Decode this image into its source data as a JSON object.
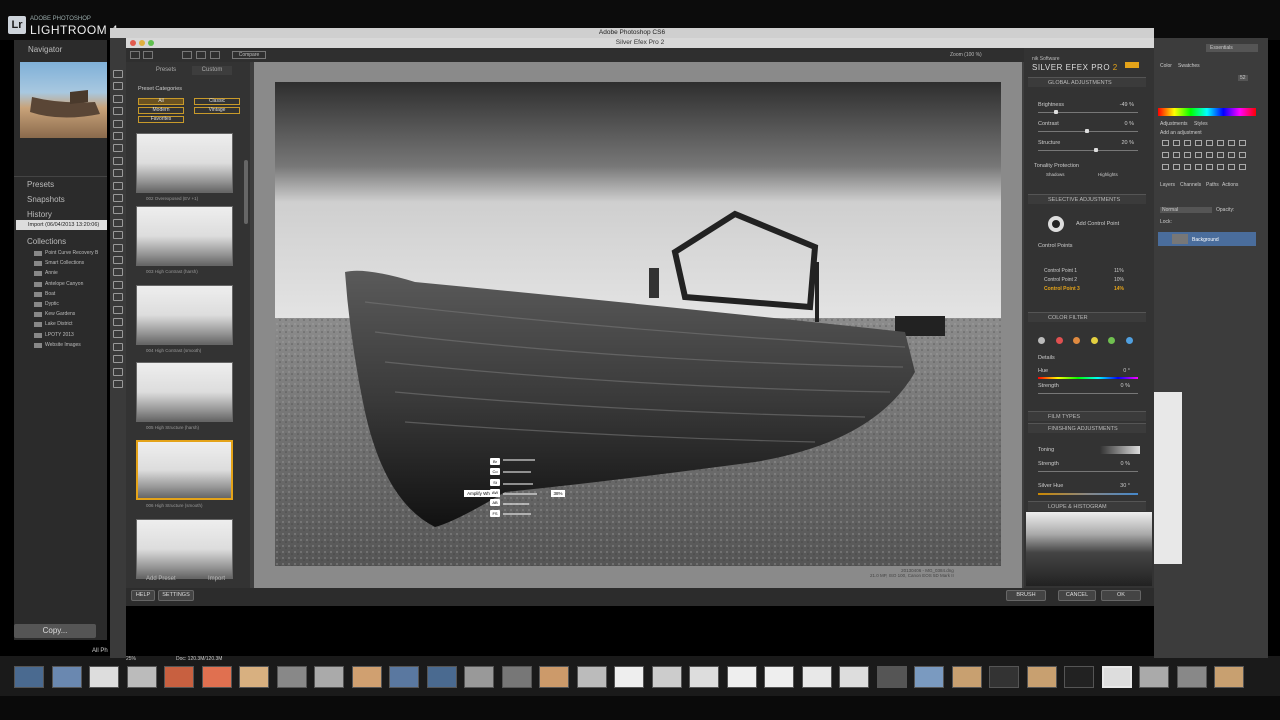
{
  "lightroom": {
    "brand_small": "ADOBE PHOTOSHOP",
    "brand_big": "LIGHTROOM 4",
    "logo": "Lr",
    "navigator": "Navigator",
    "presets": "Presets",
    "snapshots": "Snapshots",
    "history": "History",
    "history_item": "Import (06/04/2013 13:20:06)",
    "collections": "Collections",
    "collection_items": [
      "Point Curve Recovery B",
      "Smart Collections",
      "Annie",
      "Antelope Canyon",
      "Boat",
      "Dyptic",
      "Kew Gardens",
      "Lake District",
      "LPOTY 2013",
      "Website Images"
    ],
    "copy_button": "Copy...",
    "all_photos": "All Ph"
  },
  "photoshop": {
    "title": "Adobe Photoshop CS6",
    "workspace": "Essentials",
    "color_tab": "Color",
    "swatches_tab": "Swatches",
    "adjustments_tab": "Adjustments",
    "styles_tab": "Styles",
    "add_adjustment": "Add an adjustment",
    "layers_tab": "Layers",
    "channels_tab": "Channels",
    "paths_tab": "Paths",
    "actions_tab": "Actions",
    "blend_mode": "Normal",
    "opacity_label": "Opacity:",
    "lock_label": "Lock:",
    "layer_name": "Background",
    "color_value": "52",
    "doc_zoom": "25%",
    "doc_size": "Doc: 120.3M/120.3M"
  },
  "silver_efex": {
    "title": "Silver Efex Pro 2",
    "compare_button": "Compare",
    "zoom_label": "Zoom (100 %)",
    "tabs": [
      "Presets",
      "Custom"
    ],
    "preset_categories_label": "Preset Categories",
    "categories": [
      "All",
      "Classic",
      "Modern",
      "Vintage",
      "Favorites"
    ],
    "presets": [
      "002 Overexposed (EV +1)",
      "003 High Contrast (harsh)",
      "004 High Contrast (smooth)",
      "005 High Structure (harsh)",
      "006 High Structure (smooth)"
    ],
    "add_preset": "Add Preset",
    "import": "Import",
    "logo_company": "nik Software",
    "logo_product": "SILVER EFEX PRO",
    "logo_version": "2",
    "global_adjustments": "GLOBAL ADJUSTMENTS",
    "brightness_label": "Brightness",
    "brightness_value": "-49 %",
    "contrast_label": "Contrast",
    "contrast_value": "0 %",
    "structure_label": "Structure",
    "structure_value": "20 %",
    "tonality_protection": "Tonality Protection",
    "shadows": "Shadows",
    "highlights": "Highlights",
    "selective_adjustments": "SELECTIVE ADJUSTMENTS",
    "add_control_point": "Add Control Point",
    "control_points_label": "Control Points",
    "control_points": [
      {
        "name": "Control Point 1",
        "value": "11%"
      },
      {
        "name": "Control Point 2",
        "value": "10%"
      },
      {
        "name": "Control Point 3",
        "value": "14%"
      }
    ],
    "color_filter": "COLOR FILTER",
    "details": "Details",
    "hue_label": "Hue",
    "hue_value": "0 °",
    "strength_label": "Strength",
    "strength_value": "0 %",
    "film_types": "FILM TYPES",
    "finishing_adjustments": "FINISHING ADJUSTMENTS",
    "toning_label": "Toning",
    "toning_strength_label": "Strength",
    "toning_strength_value": "0 %",
    "silver_hue_label": "Silver Hue",
    "silver_hue_value": "30 °",
    "loupe_histogram": "LOUPE & HISTOGRAM",
    "photo_filename": "20130406 - MG_0384.dng",
    "photo_info": "21.0 MP, ISO 100, Canon EOS 5D Mark II",
    "cp_overlay_label": "Amplify Whites",
    "cp_overlay_value": "38%",
    "cp_letters": [
      "Br",
      "Co",
      "St",
      "AW",
      "AB",
      "FS"
    ],
    "buttons": {
      "help": "HELP",
      "settings": "SETTINGS",
      "brush": "BRUSH",
      "cancel": "CANCEL",
      "ok": "OK"
    },
    "colors": {
      "accent": "#e4a319",
      "filter_dots": [
        "#bbbbbb",
        "#e05050",
        "#e08a40",
        "#e4d040",
        "#70c050",
        "#50a0e0"
      ]
    }
  }
}
